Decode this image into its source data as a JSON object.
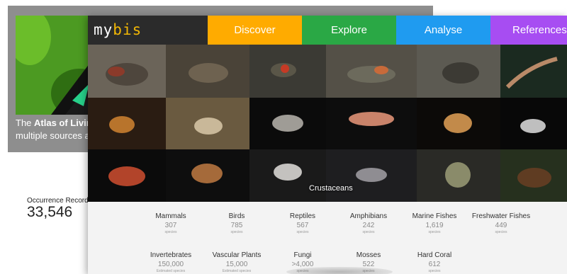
{
  "background_window": {
    "caption_prefix": "The ",
    "caption_bold": "Atlas of Livin",
    "caption_line2": "multiple sources a",
    "stat_label": "Occurrence Record",
    "stat_value": "33,546"
  },
  "app": {
    "logo_part1": "my",
    "logo_part2": "bis",
    "nav": {
      "discover": "Discover",
      "explore": "Explore",
      "analyse": "Analyse",
      "references": "References"
    },
    "colors": {
      "discover": "#ffab00",
      "explore": "#2aa845",
      "analyse": "#1f9bf0",
      "references": "#a74df2"
    },
    "mosaic_caption": "Crustaceans",
    "stats_row1": [
      {
        "name": "Mammals",
        "value": "307",
        "sub": "species"
      },
      {
        "name": "Birds",
        "value": "785",
        "sub": "species"
      },
      {
        "name": "Reptiles",
        "value": "567",
        "sub": "species"
      },
      {
        "name": "Amphibians",
        "value": "242",
        "sub": "species"
      },
      {
        "name": "Marine Fishes",
        "value": "1,619",
        "sub": "species"
      },
      {
        "name": "Freshwater Fishes",
        "value": "449",
        "sub": "species"
      }
    ],
    "stats_row2": [
      {
        "name": "Invertebrates",
        "value": "150,000",
        "sub": "Estimated species"
      },
      {
        "name": "Vascular Plants",
        "value": "15,000",
        "sub": "Estimated species"
      },
      {
        "name": "Fungi",
        "value": ">4,000",
        "sub": "species"
      },
      {
        "name": "Mosses",
        "value": "522",
        "sub": "species"
      },
      {
        "name": "Hard Coral",
        "value": "612",
        "sub": "species"
      }
    ]
  }
}
